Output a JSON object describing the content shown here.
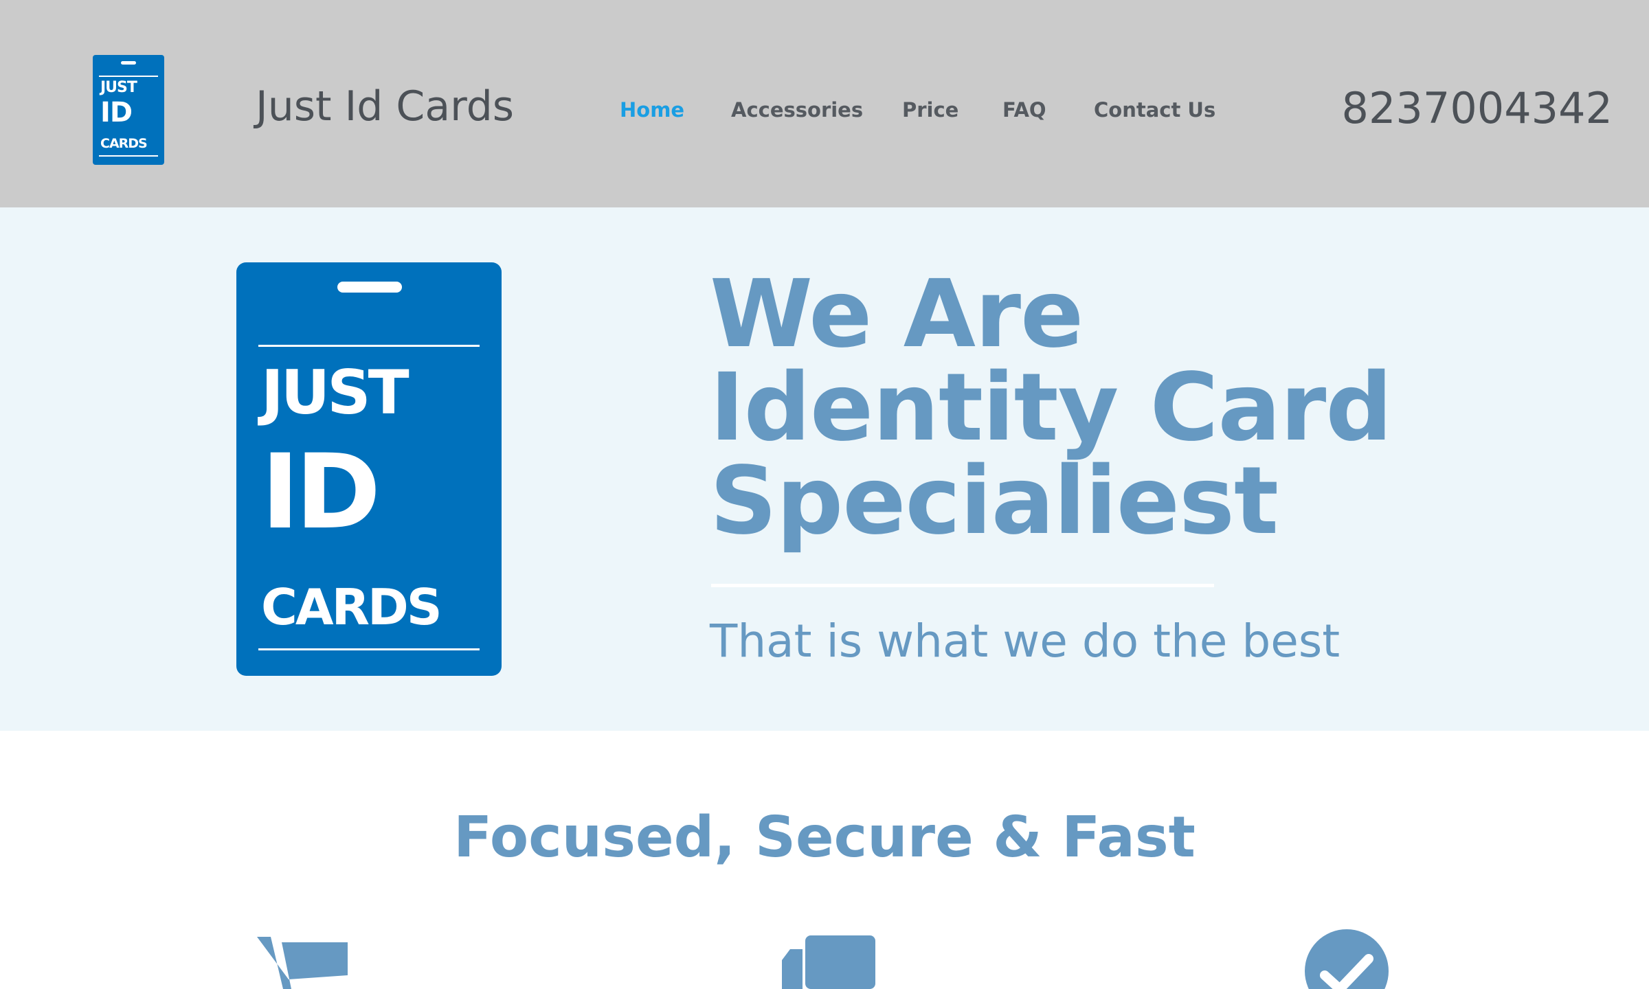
{
  "header": {
    "logo": {
      "line1": "JUST",
      "line2": "ID",
      "line3": "CARDS"
    },
    "site_title": "Just Id Cards",
    "nav": [
      {
        "label": "Home",
        "active": true
      },
      {
        "label": "Accessories",
        "active": false
      },
      {
        "label": "Price",
        "active": false
      },
      {
        "label": "FAQ",
        "active": false
      },
      {
        "label": "Contact Us",
        "active": false
      }
    ],
    "phone": "8237004342"
  },
  "hero": {
    "logo": {
      "line1": "JUST",
      "line2": "ID",
      "line3": "CARDS"
    },
    "headline": [
      "We Are",
      "Identity Card",
      "Specialiest"
    ],
    "tagline": "That is what we do the best"
  },
  "features": {
    "title": "Focused, Secure & Fast",
    "icons": [
      "shopping-cart-icon",
      "delivery-truck-icon",
      "check-circle-icon"
    ]
  },
  "colors": {
    "header_bg": "#cbcbcb",
    "hero_bg": "#edf6fa",
    "brand_blue": "#0071bc",
    "accent_text": "#6699c2",
    "nav_active": "#1a9ee3",
    "dark_text": "#4c5157"
  }
}
